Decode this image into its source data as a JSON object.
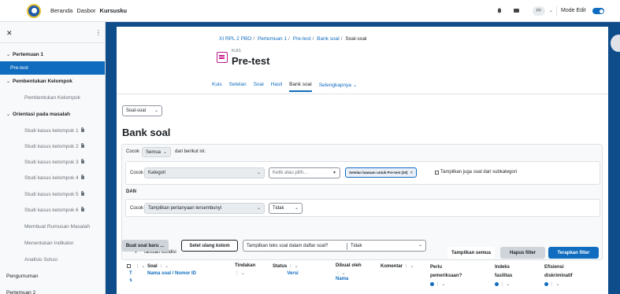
{
  "navbar": {
    "site_links": [
      "Beranda",
      "Dasbor",
      "Kursusku"
    ],
    "current_link_index": 2,
    "avatar_initials": "PF",
    "edit_mode_label": "Mode Edit"
  },
  "drawer": {
    "items": [
      {
        "label": "Pertemuan 1",
        "type": "section"
      },
      {
        "label": "Pre-test",
        "type": "active"
      },
      {
        "label": "Pembentukan Kelompok",
        "type": "section"
      },
      {
        "label": "Pembentukan Kelompok",
        "type": "sub"
      },
      {
        "label": "Orientasi pada masalah",
        "type": "section"
      },
      {
        "label": "Studi kasus kelompok 1",
        "type": "sub-locked"
      },
      {
        "label": "Studi kasus kelompok 2",
        "type": "sub-locked"
      },
      {
        "label": "Studi kasus kelompok 3",
        "type": "sub-locked"
      },
      {
        "label": "Studi kasus kelompok 4",
        "type": "sub-locked"
      },
      {
        "label": "Studi kasus kelompok 5",
        "type": "sub-locked"
      },
      {
        "label": "Studi kasus kelompok 6",
        "type": "sub-locked"
      },
      {
        "label": "Membuat Rumusan Masalah",
        "type": "sub"
      },
      {
        "label": "Menentukan Indikator",
        "type": "sub"
      },
      {
        "label": "Analisis Solusi",
        "type": "sub"
      },
      {
        "label": "Pengumuman",
        "type": "plain"
      },
      {
        "label": "Pertemuan 2",
        "type": "plain"
      }
    ]
  },
  "breadcrumb": [
    "XI RPL 2 PBO",
    "Pertemuan 1",
    "Pre-test",
    "Bank soal",
    "Soal-soal"
  ],
  "header": {
    "activity_type": "KUIS",
    "title": "Pre-test"
  },
  "secondary_nav": {
    "tabs": [
      "Kuis",
      "Setelan",
      "Soal",
      "Hasil",
      "Bank soal",
      "Selengkapnya"
    ],
    "active_index": 4
  },
  "page_select": "Soal-soal",
  "bank_title": "Bank soal",
  "filter": {
    "match_label": "Cocok",
    "match_mode": "Semua",
    "match_suffix": "dari berikut ini:",
    "row1": {
      "match_label": "Cocok",
      "field": "Kategori",
      "search_placeholder": "Ketik atau pilih...",
      "chip": "Setelan bawaan untuk Pre-test (20)",
      "subcat_label": "Tampilkan juga soal dari subkategori"
    },
    "and_label": "DAN",
    "row2": {
      "match_label": "Cocok",
      "field": "Tampilkan pertanyaan tersembunyi",
      "value": "Tidak"
    },
    "add_condition": "Tambah kondisi",
    "show_all": "Tampilkan semua",
    "clear": "Hapus filter",
    "apply": "Terapkan filter"
  },
  "toolbar": {
    "new_question": "Buat soal baru ...",
    "reset_columns": "Setel ulang kolom",
    "show_text_label": "Tampilkan teks soal dalam daftar soal?",
    "show_text_value": "Tidak"
  },
  "table": {
    "col_question": "Soal",
    "col_question_sub": "Nama soal / Nomor ID",
    "col_action": "Tindakan",
    "col_status": "Status",
    "col_status_sub": "Versi",
    "col_created": "Dibuat oleh",
    "col_created_sub": "Nama",
    "col_comment": "Komentar",
    "col_review": "Perlu pemeriksaan?",
    "col_facility": "Indeks fasilitas",
    "col_discrimination": "Efisiensi diskriminatif"
  }
}
